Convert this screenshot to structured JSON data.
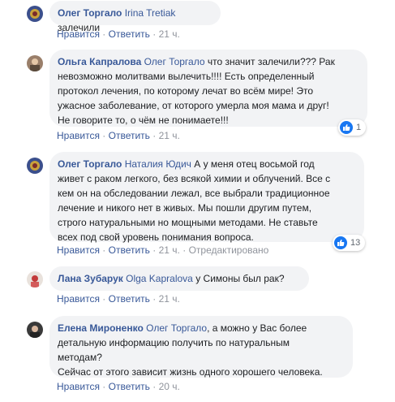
{
  "colors": {
    "link": "#385898",
    "bubble": "#f2f3f5",
    "like": "#1877f2",
    "meta": "#90949c"
  },
  "actions": {
    "like": "Нравится",
    "reply": "Ответить",
    "dot": "·",
    "tag_suggestion": "Отредактировано"
  },
  "comments": [
    {
      "author": "Олег Торгало",
      "mention": "Irina Tretiak",
      "text": "залечили",
      "time": "21 ч.",
      "avatar_icon": "avatar-oleg-icon"
    },
    {
      "author": "Ольга Капралова",
      "mention": "Олег Торгало",
      "lines": [
        "что значит залечили??? Рак",
        "невозможно молитвами вылечить!!!! Есть определенный",
        "протокол лечения, по которому лечат во всём мире! Это",
        "ужасное заболевание, от которого умерла моя мама и друг!",
        "Не говорите то, о чём не понимаете!!!"
      ],
      "time": "21 ч.",
      "reactions": "1",
      "avatar_icon": "avatar-olga-icon"
    },
    {
      "author": "Олег Торгало",
      "mention": "Наталия Юдич",
      "lines": [
        "А у меня отец восьмой год",
        "живет с раком легкого, без всякой химии и облучений. Все с",
        "кем он на обследовании лежал, все выбрали традиционное",
        "лечение и никого нет в живых. Мы пошли другим путем,",
        "строго натуральными но мощными методами. Не ставьте",
        "всех под свой уровень понимания вопроса."
      ],
      "time": "21 ч.",
      "edited": "Отредактировано",
      "reactions": "13",
      "avatar_icon": "avatar-oleg-icon"
    },
    {
      "author": "Лана Зубарук",
      "mention": "Olga Kapralova",
      "text": "у Симоны был рак?",
      "time": "21 ч.",
      "avatar_icon": "avatar-lana-icon"
    },
    {
      "author": "Елена Мироненко",
      "mention": "Олег Торгало",
      "lines": [
        ", а можно у Вас более",
        "детальную информацию получить по натуральным",
        "методам?",
        "Сейчас от этого зависит жизнь одного хорошего человека."
      ],
      "time": "20 ч.",
      "avatar_icon": "avatar-elena-icon"
    }
  ]
}
